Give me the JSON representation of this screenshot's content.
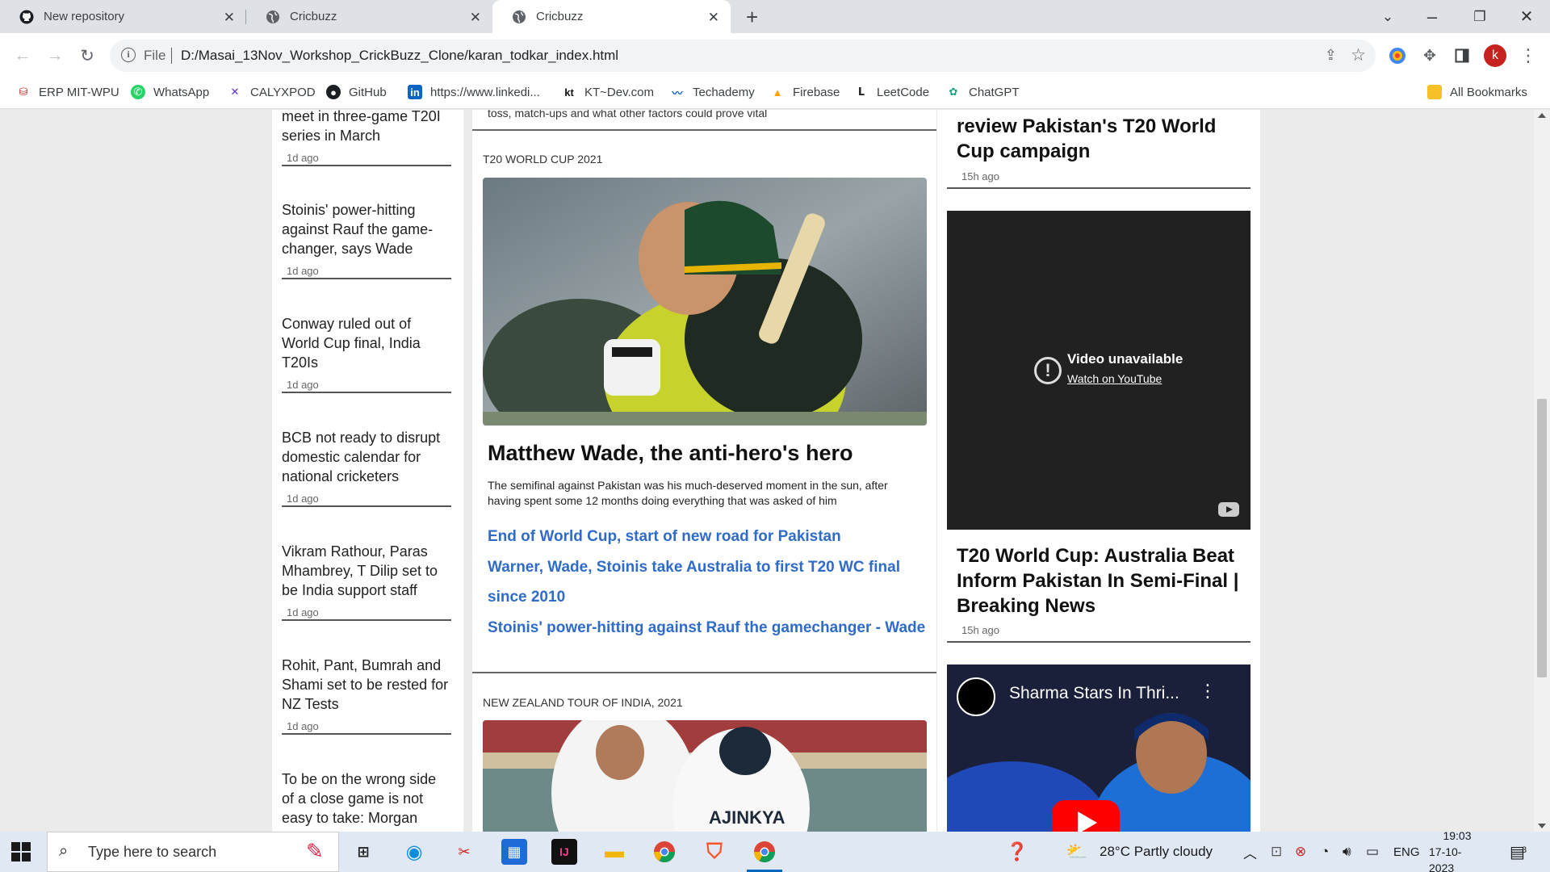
{
  "browser": {
    "tabs": [
      {
        "title": "New repository",
        "icon": "github-icon"
      },
      {
        "title": "Cricbuzz",
        "icon": "globe-icon"
      },
      {
        "title": "Cricbuzz",
        "icon": "globe-icon",
        "active": true
      }
    ],
    "address": {
      "scheme_label": "File",
      "url": "D:/Masai_13Nov_Workshop_CrickBuzz_Clone/karan_todkar_index.html"
    },
    "profile_initial": "k",
    "bookmarks": [
      {
        "label": "ERP MIT-WPU",
        "icon": "erp-icon"
      },
      {
        "label": "WhatsApp",
        "icon": "whatsapp-icon"
      },
      {
        "label": "CALYXPOD",
        "icon": "calyxpod-icon"
      },
      {
        "label": "GitHub",
        "icon": "github-icon"
      },
      {
        "label": "https://www.linkedi...",
        "icon": "linkedin-icon"
      },
      {
        "label": "KT~Dev.com",
        "icon": "kt-icon"
      },
      {
        "label": "Techademy",
        "icon": "techademy-icon"
      },
      {
        "label": "Firebase",
        "icon": "firebase-icon"
      },
      {
        "label": "LeetCode",
        "icon": "leetcode-icon"
      },
      {
        "label": "ChatGPT",
        "icon": "chatgpt-icon"
      }
    ],
    "all_bookmarks": "All Bookmarks"
  },
  "left_news": [
    {
      "title": "meet in three-game T20I series in March",
      "ago": "1d ago"
    },
    {
      "title": "Stoinis' power-hitting against Rauf the game-changer, says Wade",
      "ago": "1d ago"
    },
    {
      "title": "Conway ruled out of World Cup final, India T20Is",
      "ago": "1d ago"
    },
    {
      "title": "BCB not ready to disrupt domestic calendar for national cricketers",
      "ago": "1d ago"
    },
    {
      "title": "Vikram Rathour, Paras Mhambrey, T Dilip set to be India support staff",
      "ago": "1d ago"
    },
    {
      "title": "Rohit, Pant, Bumrah and Shami set to be rested for NZ Tests",
      "ago": "1d ago"
    },
    {
      "title": "To be on the wrong side of a close game is not easy to take: Morgan",
      "ago": ""
    }
  ],
  "middle": {
    "top_text": "toss, match-ups and what other factors could prove vital",
    "section1": "T20 WORLD CUP 2021",
    "headline": "Matthew Wade, the anti-hero's hero",
    "summary": "The semifinal against Pakistan was his much-deserved moment in the sun, after having spent some 12 months doing everything that was asked of him",
    "links": [
      "End of World Cup, start of new road for Pakistan",
      "Warner, Wade, Stoinis take Australia to first T20 WC final since 2010",
      "Stoinis' power-hitting against Rauf the gamechanger - Wade"
    ],
    "section2": "NEW ZEALAND TOUR OF INDIA, 2021",
    "image2_text": "AJINKYA"
  },
  "right": {
    "top_headline": "review Pakistan's T20 World Cup campaign",
    "top_ago": "15h ago",
    "video1": {
      "title": "Video unavailable",
      "link": "Watch on YouTube"
    },
    "mid_headline": "T20 World Cup: Australia Beat Inform Pakistan In Semi-Final | Breaking News",
    "mid_ago": "15h ago",
    "video2": {
      "title": "Sharma Stars In Thri..."
    }
  },
  "taskbar": {
    "search_placeholder": "Type here to search",
    "weather": "28°C  Partly cloudy",
    "language": "ENG",
    "time": "19:03",
    "date": "17-10-2023",
    "notification_count": "3"
  },
  "colors": {
    "link": "#2f6bc9",
    "accent_red": "#d93025",
    "tab_strip": "#dee1e6"
  }
}
